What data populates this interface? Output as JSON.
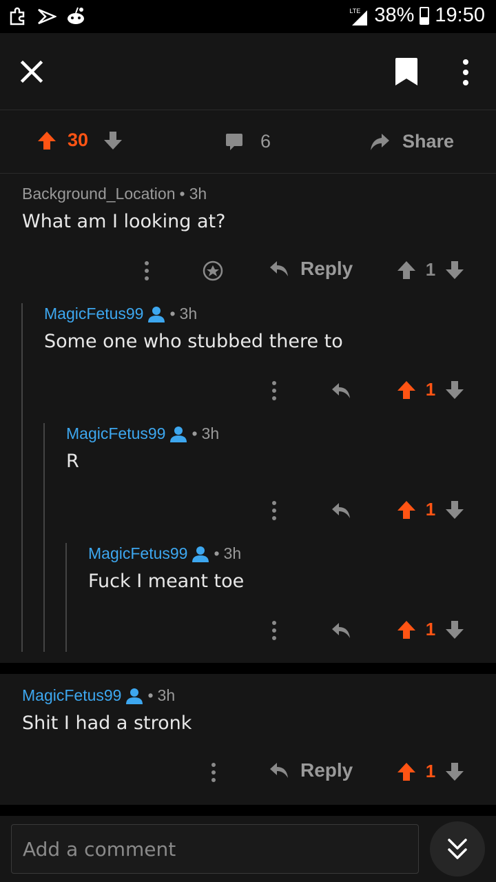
{
  "status_bar": {
    "network": "LTE",
    "battery": "38%",
    "battery_level": 0.38,
    "time": "19:50"
  },
  "post": {
    "score": "30",
    "comment_count": "6",
    "share_label": "Share"
  },
  "colors": {
    "upvote_active": "#ff5414",
    "username_blue": "#3da7ef",
    "muted": "#9a9a9a"
  },
  "comments": [
    {
      "author": "Background_Location",
      "time": "3h",
      "body": "What am I looking at?",
      "reply_label": "Reply",
      "score": "1",
      "upvoted": false
    },
    {
      "author": "MagicFetus99",
      "time": "3h",
      "body": "Some one who stubbed there to",
      "score": "1",
      "upvoted": true
    },
    {
      "author": "MagicFetus99",
      "time": "3h",
      "body": "R",
      "score": "1",
      "upvoted": true
    },
    {
      "author": "MagicFetus99",
      "time": "3h",
      "body": "Fuck I meant toe",
      "score": "1",
      "upvoted": true
    },
    {
      "author": "MagicFetus99",
      "time": "3h",
      "body": "Shit I had a stronk",
      "reply_label": "Reply",
      "score": "1",
      "upvoted": true
    }
  ],
  "composer": {
    "placeholder": "Add a comment"
  },
  "icons": [
    "puzzle-icon",
    "sprint-icon",
    "reddit-icon",
    "close-icon",
    "bookmark-icon",
    "more-vertical-icon",
    "upvote-icon",
    "downvote-icon",
    "comment-icon",
    "share-icon",
    "award-icon",
    "reply-icon",
    "op-user-icon",
    "double-chevron-down-icon"
  ]
}
